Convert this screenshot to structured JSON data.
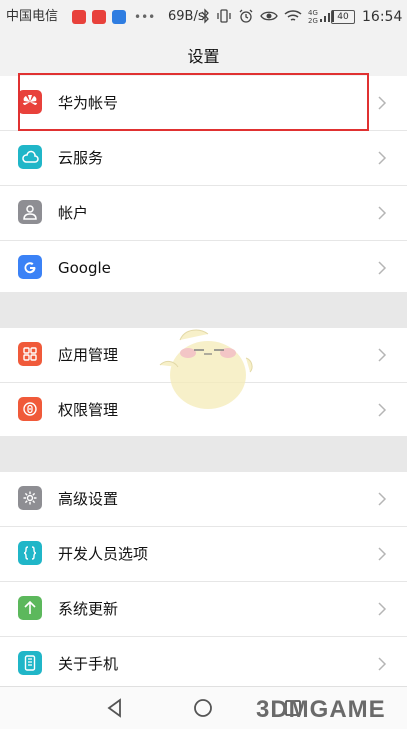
{
  "status_bar": {
    "carrier": "中国电信",
    "speed": "69B/s",
    "battery": "40",
    "time": "16:54"
  },
  "title": "设置",
  "groups": [
    {
      "items": [
        {
          "label": "华为帐号",
          "icon": "huawei-logo-icon",
          "color": "#e8413b"
        },
        {
          "label": "云服务",
          "icon": "cloud-icon",
          "color": "#20b6c8"
        },
        {
          "label": "帐户",
          "icon": "user-icon",
          "color": "#8e8e93"
        },
        {
          "label": "Google",
          "icon": "google-icon",
          "color": "#3b82f6"
        }
      ]
    },
    {
      "items": [
        {
          "label": "应用管理",
          "icon": "apps-grid-icon",
          "color": "#f05a3a"
        },
        {
          "label": "权限管理",
          "icon": "permission-icon",
          "color": "#f05a3a"
        }
      ]
    },
    {
      "items": [
        {
          "label": "高级设置",
          "icon": "gear-icon",
          "color": "#8e8e93"
        },
        {
          "label": "开发人员选项",
          "icon": "developer-braces-icon",
          "color": "#20b6c8"
        },
        {
          "label": "系统更新",
          "icon": "update-arrow-icon",
          "color": "#5cb85c"
        },
        {
          "label": "关于手机",
          "icon": "phone-icon",
          "color": "#20b6c8"
        }
      ]
    }
  ],
  "watermark": "3DMGAME"
}
